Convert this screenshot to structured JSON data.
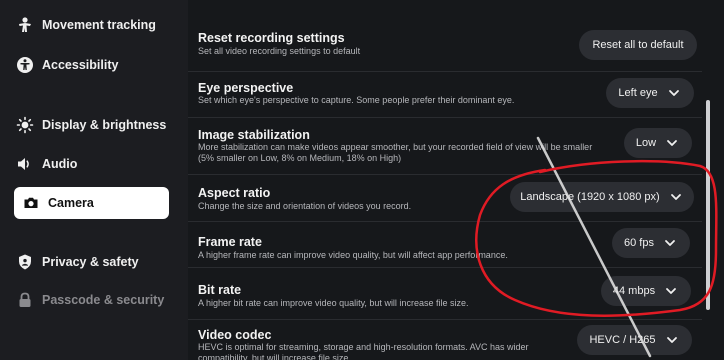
{
  "sidebar": {
    "items": [
      {
        "label": "Movement tracking",
        "icon": "person-icon"
      },
      {
        "label": "Accessibility",
        "icon": "accessibility-icon"
      },
      {
        "label": "Display & brightness",
        "icon": "brightness-icon"
      },
      {
        "label": "Audio",
        "icon": "speaker-icon"
      },
      {
        "label": "Camera",
        "icon": "camera-icon",
        "active": true
      },
      {
        "label": "Privacy & safety",
        "icon": "shield-icon"
      },
      {
        "label": "Passcode & security",
        "icon": "lock-icon",
        "disabled": true
      }
    ]
  },
  "settings": [
    {
      "title": "Reset recording settings",
      "desc": "Set all video recording settings to default",
      "control": "Reset all to default"
    },
    {
      "title": "Eye perspective",
      "desc": "Set which eye's perspective to capture. Some people prefer their dominant eye.",
      "control": "Left eye"
    },
    {
      "title": "Image stabilization",
      "desc": "More stabilization can make videos appear smoother, but your recorded field of view will be smaller (5% smaller on Low, 8% on Medium, 18% on High)",
      "control": "Low"
    },
    {
      "title": "Aspect ratio",
      "desc": "Change the size and orientation of videos you record.",
      "control": "Landscape (1920 x 1080 px)"
    },
    {
      "title": "Frame rate",
      "desc": "A higher frame rate can improve video quality, but will affect app performance.",
      "control": "60 fps"
    },
    {
      "title": "Bit rate",
      "desc": "A higher bit rate can improve video quality, but will increase file size.",
      "control": "44 mbps"
    },
    {
      "title": "Video codec",
      "desc": "HEVC is optimal for streaming, storage and high-resolution formats. AVC has wider compatibility, but will increase file size.",
      "control": "HEVC / H265"
    }
  ],
  "colors": {
    "annotation": "#e01b24",
    "accent": "#ffffff"
  }
}
